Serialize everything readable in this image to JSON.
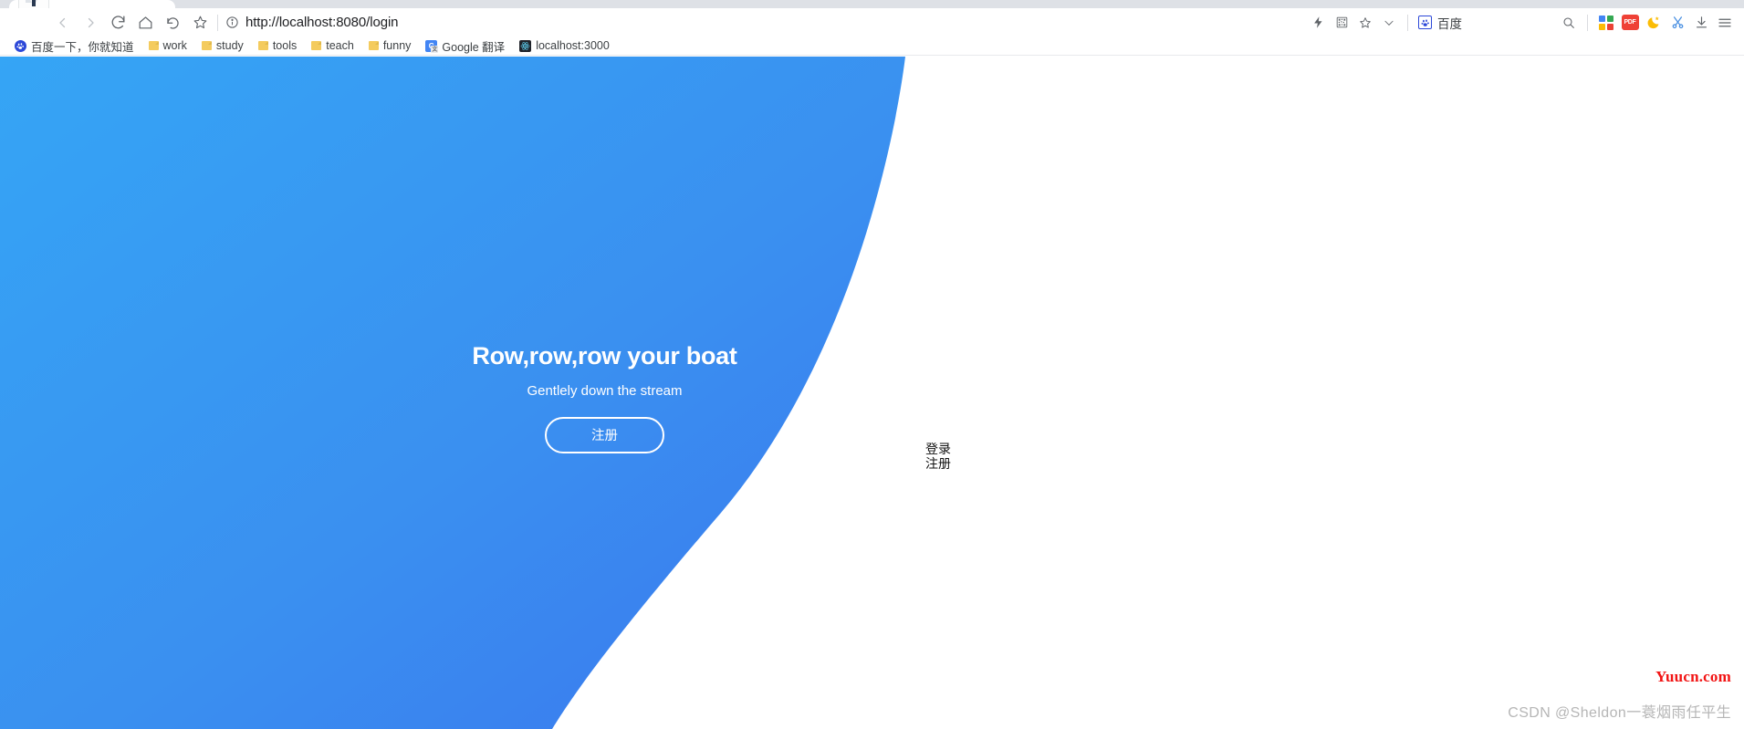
{
  "browser": {
    "tab": {
      "favicon_name": "anime-avatar-favicon",
      "title": ""
    },
    "nav": {
      "back_label": "‹",
      "forward_label": "›",
      "reload_label": "reload",
      "home_label": "home",
      "undo_label": "undo",
      "bookmark_label": "bookmark-star"
    },
    "address": {
      "info_icon": "info-circle-icon",
      "scheme": "http://",
      "host": "localhost:8080",
      "path": "/login",
      "full_url": "http://localhost:8080/login"
    },
    "omnibox_icons": [
      {
        "name": "lightning-icon",
        "label": "⚡"
      },
      {
        "name": "qr-code-icon",
        "label": "qr"
      },
      {
        "name": "star-icon",
        "label": "☆"
      },
      {
        "name": "chevron-down-icon",
        "label": "∨"
      }
    ],
    "extension": {
      "name": "baidu-extension",
      "label": "百度"
    },
    "toolbar_right": [
      {
        "name": "search-icon",
        "label": "search"
      },
      {
        "name": "apps-grid-icon",
        "label": "apps"
      },
      {
        "name": "pdf-icon",
        "label": "PDF"
      },
      {
        "name": "night-mode-icon",
        "label": "moon"
      },
      {
        "name": "screenshot-scissors-icon",
        "label": "scissors"
      },
      {
        "name": "downloads-icon",
        "label": "download"
      },
      {
        "name": "menu-icon",
        "label": "menu"
      }
    ],
    "bookmarks": [
      {
        "name": "bookmark-baidu",
        "label": "百度一下，你就知道",
        "icon": "baidu-paw-icon"
      },
      {
        "name": "bookmark-work",
        "label": "work",
        "icon": "folder-icon"
      },
      {
        "name": "bookmark-study",
        "label": "study",
        "icon": "folder-icon"
      },
      {
        "name": "bookmark-tools",
        "label": "tools",
        "icon": "folder-icon"
      },
      {
        "name": "bookmark-teach",
        "label": "teach",
        "icon": "folder-icon"
      },
      {
        "name": "bookmark-funny",
        "label": "funny",
        "icon": "folder-icon"
      },
      {
        "name": "bookmark-google-translate",
        "label": "Google 翻译",
        "icon": "google-translate-icon"
      },
      {
        "name": "bookmark-localhost-3000",
        "label": "localhost:3000",
        "icon": "react-icon"
      }
    ]
  },
  "page": {
    "hero": {
      "title": "Row,row,row your boat",
      "subtitle": "Gentlely down the stream",
      "button_label": "注册"
    },
    "side_links": [
      {
        "name": "link-login",
        "label": "登录"
      },
      {
        "name": "link-register",
        "label": "注册"
      }
    ],
    "colors": {
      "blue_light": "#35a0f2",
      "blue_dark": "#3b7ef0",
      "white": "#ffffff",
      "watermark_red": "#f21313",
      "watermark_gray": "#b6b6b6"
    }
  },
  "watermarks": {
    "site": "Yuucn.com",
    "csdn": "CSDN @Sheldon一蓑烟雨任平生"
  }
}
